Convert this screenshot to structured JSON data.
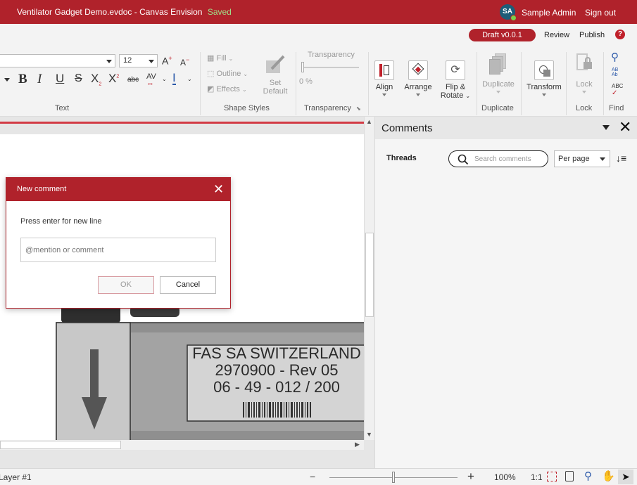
{
  "titlebar": {
    "doc_title": "Ventilator Gadget Demo.evdoc - Canvas Envision",
    "status": "Saved",
    "avatar_initials": "SA",
    "user_name": "Sample Admin",
    "sign_out": "Sign out"
  },
  "ribbon": {
    "draft_label": "Draft v0.0.1",
    "review_label": "Review",
    "publish_label": "Publish",
    "help_glyph": "?",
    "text_group": {
      "label": "Text",
      "font_size": "12",
      "buttons": [
        "B",
        "I",
        "U",
        "S",
        "X",
        "X",
        "abc",
        "AV",
        "I"
      ]
    },
    "shape_styles": {
      "label": "Shape Styles",
      "fill": "Fill",
      "outline": "Outline",
      "effects": "Effects",
      "set_default_1": "Set",
      "set_default_2": "Default"
    },
    "transparency": {
      "label": "Transparency",
      "title": "Transparency",
      "value": "0 %"
    },
    "align": "Align",
    "arrange": "Arrange",
    "flip_rotate_1": "Flip &",
    "flip_rotate_2": "Rotate",
    "duplicate": {
      "button": "Duplicate",
      "group": "Duplicate"
    },
    "transform": "Transform",
    "lock": {
      "button": "Lock",
      "group": "Lock"
    },
    "find": "Find",
    "find_icon_ab": "AB",
    "find_icon_ab2": "Ab",
    "find_icon_abc": "ABC"
  },
  "canvas": {
    "label_lines": [
      "FAS SA SWITZERLAND",
      "2970900 - Rev 05",
      "06 - 49   -   012 / 200"
    ],
    "colors": {
      "page": "#ffffff",
      "device": "#9a9a9a",
      "label": "#d4d4d4"
    }
  },
  "comments_panel": {
    "title": "Comments",
    "threads_label": "Threads",
    "search_placeholder": "Search comments",
    "per_page": "Per page"
  },
  "dialog": {
    "title": "New comment",
    "hint": "Press enter for new line",
    "input_placeholder": "@mention or comment",
    "ok_label": "OK",
    "cancel_label": "Cancel"
  },
  "statusbar": {
    "layer": "Layer #1",
    "minus": "−",
    "plus": "+",
    "zoom": "100%",
    "ratio": "1:1"
  },
  "theme": {
    "brand_red": "#b0222b",
    "saved_green": "#9fe08a"
  }
}
